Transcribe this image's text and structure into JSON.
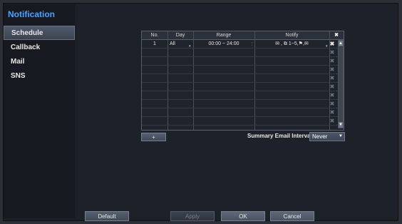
{
  "sidebar": {
    "title": "Notification",
    "items": [
      {
        "label": "Schedule"
      },
      {
        "label": "Callback"
      },
      {
        "label": "Mail"
      },
      {
        "label": "SNS"
      }
    ]
  },
  "table": {
    "headers": [
      "No.",
      "Day",
      "Range",
      "Notify"
    ],
    "row1": {
      "no": "1",
      "day": "All",
      "range": "00:00 ~ 24:00",
      "notify": "✉ , ⧉ 1~5,⚑,✉"
    }
  },
  "actions": {
    "add_label": "+",
    "summary_label": "Summary Email Interval",
    "summary_value": "Never"
  },
  "footer": {
    "default_label": "Default",
    "apply_label": "Apply",
    "ok_label": "OK",
    "cancel_label": "Cancel"
  },
  "icons": {
    "delete": "x-icon"
  }
}
